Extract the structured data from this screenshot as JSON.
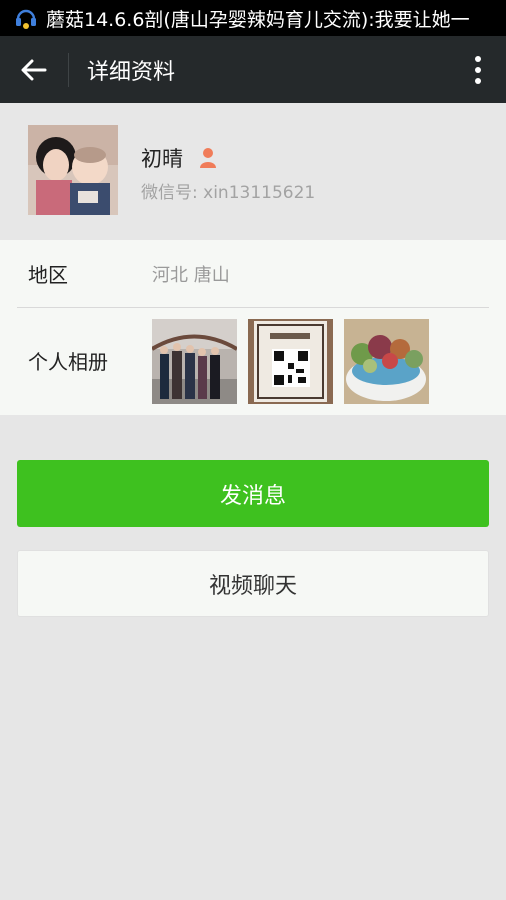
{
  "status_bar": {
    "text": "蘑菇14.6.6剖(唐山孕婴辣妈育儿交流):我要让她一"
  },
  "toolbar": {
    "title": "详细资料",
    "back_icon": "arrow-left-icon",
    "more_icon": "more-vertical-icon"
  },
  "profile": {
    "name": "初晴",
    "gender": "female",
    "wechat_id": "微信号: xin13115621",
    "colors": {
      "gender_icon": "#f07c59"
    }
  },
  "info": {
    "region_label": "地区",
    "region_value": "河北  唐山",
    "album_label": "个人相册"
  },
  "actions": {
    "send_message": "发消息",
    "video_chat": "视频聊天"
  },
  "colors": {
    "accent": "#3ec11f",
    "toolbar": "#25292b"
  }
}
